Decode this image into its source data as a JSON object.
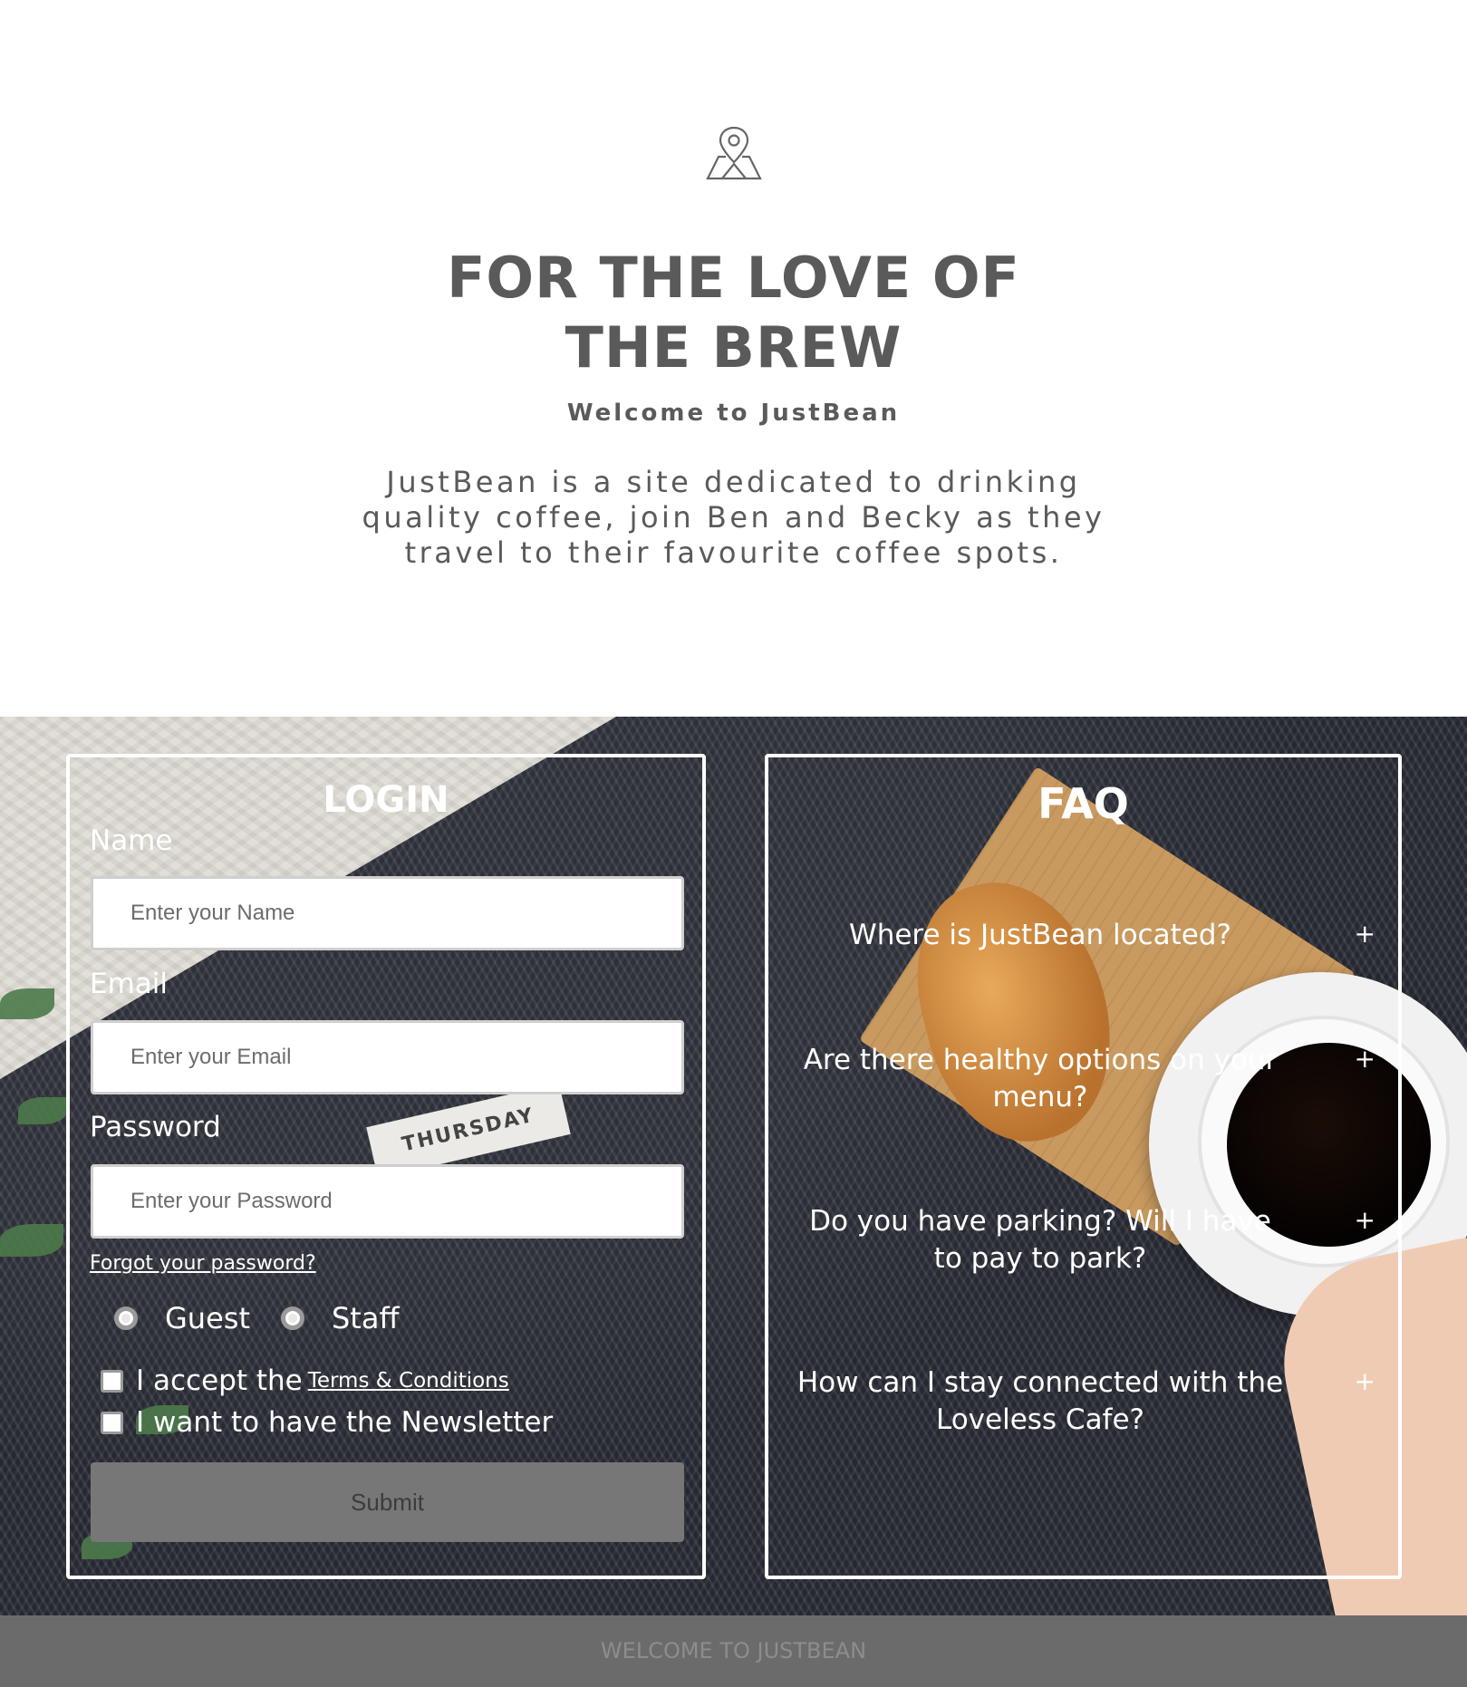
{
  "hero": {
    "icon": "map-pin-icon",
    "title_line1": "FOR THE LOVE OF",
    "title_line2": "THE BREW",
    "subtitle": "Welcome to JustBean",
    "intro": "JustBean is a site dedicated to drinking quality coffee, join Ben and Becky as they travel to their favourite coffee spots."
  },
  "background": {
    "card_text": "THURSDAY"
  },
  "login": {
    "heading": "LOGIN",
    "name_label": "Name",
    "name_placeholder": "Enter your Name",
    "email_label": "Email",
    "email_placeholder": "Enter your Email",
    "password_label": "Password",
    "password_placeholder": "Enter your Password",
    "forgot_link": "Forgot your password?",
    "role_options": [
      "Guest",
      "Staff"
    ],
    "terms_prefix": "I accept the",
    "terms_link": "Terms & Conditions",
    "newsletter_label": "I want to have the Newsletter",
    "submit_label": "Submit"
  },
  "faq": {
    "heading": "FAQ",
    "expand_symbol": "+",
    "questions": [
      "Where is JustBean located?",
      "Are there healthy options on your menu?",
      "Do you have parking? Will I have to pay to park?",
      "How can I stay connected with the Loveless Cafe?"
    ]
  },
  "footer": {
    "text": "WELCOME TO JUSTBEAN"
  }
}
